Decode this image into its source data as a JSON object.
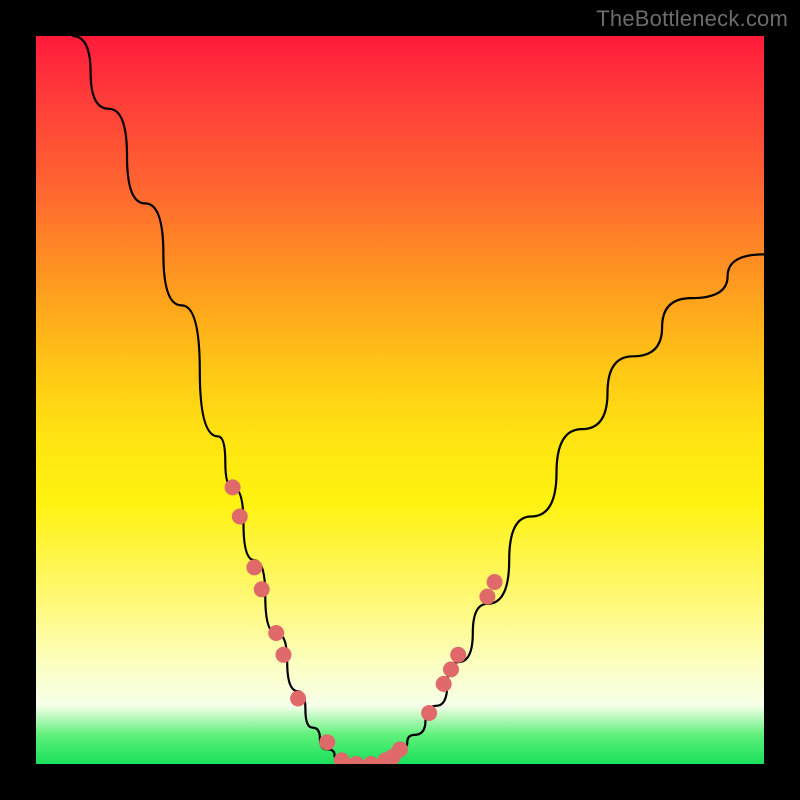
{
  "watermark": "TheBottleneck.com",
  "colors": {
    "frame": "#000000",
    "curve": "#000000",
    "dot": "#e06a6a"
  },
  "chart_data": {
    "type": "line",
    "title": "",
    "xlabel": "",
    "ylabel": "",
    "xlim": [
      0,
      100
    ],
    "ylim": [
      0,
      100
    ],
    "grid": false,
    "legend": false,
    "series": [
      {
        "name": "bottleneck-curve",
        "x": [
          5,
          10,
          15,
          20,
          25,
          27,
          30,
          33,
          36,
          38,
          40,
          42,
          44,
          46,
          48,
          50,
          52,
          55,
          58,
          62,
          68,
          75,
          82,
          90,
          100
        ],
        "y": [
          100,
          90,
          77,
          63,
          45,
          38,
          28,
          18,
          10,
          5,
          2,
          0.5,
          0,
          0,
          0.5,
          2,
          4,
          8,
          14,
          22,
          34,
          46,
          56,
          64,
          70
        ]
      }
    ],
    "markers": [
      {
        "x": 27,
        "y": 38
      },
      {
        "x": 28,
        "y": 34
      },
      {
        "x": 30,
        "y": 27
      },
      {
        "x": 31,
        "y": 24
      },
      {
        "x": 33,
        "y": 18
      },
      {
        "x": 34,
        "y": 15
      },
      {
        "x": 36,
        "y": 9
      },
      {
        "x": 40,
        "y": 3
      },
      {
        "x": 42,
        "y": 0.5
      },
      {
        "x": 44,
        "y": 0
      },
      {
        "x": 46,
        "y": 0
      },
      {
        "x": 48,
        "y": 0.5
      },
      {
        "x": 49,
        "y": 1
      },
      {
        "x": 50,
        "y": 2
      },
      {
        "x": 54,
        "y": 7
      },
      {
        "x": 56,
        "y": 11
      },
      {
        "x": 57,
        "y": 13
      },
      {
        "x": 58,
        "y": 15
      },
      {
        "x": 62,
        "y": 23
      },
      {
        "x": 63,
        "y": 25
      }
    ],
    "note": "Axes are unlabeled in the source image; x/y values are estimated percentages (0–100) read from pixel positions relative to the plot area."
  }
}
